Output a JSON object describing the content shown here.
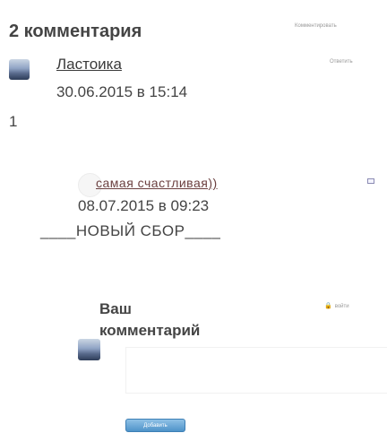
{
  "comments_section": {
    "title": "2 комментария",
    "comment_link_label": "Комментировать"
  },
  "comments": [
    {
      "author": "Ластоика",
      "reply_label": "Ответить",
      "date": "30.06.2015 в 15:14",
      "trailing_text": "1"
    },
    {
      "author": "самая счастливая))",
      "date": "08.07.2015 в 09:23",
      "text": "____НОВЫЙ СБОР____"
    }
  ],
  "form": {
    "label": "Ваш комментарий",
    "login_link_label": "войти",
    "login_icon": "lock-icon",
    "textarea_value": "",
    "submit_label": "Добавить"
  },
  "icons": {
    "mail": "mail-icon",
    "avatar": "avatar-image",
    "blank_avatar": "blank-avatar"
  },
  "colors": {
    "title": "#444444",
    "link_author_2": "#6b4040",
    "button_top": "#8fc1e6",
    "button_bottom": "#4f93c9",
    "meta_text": "#999999"
  }
}
